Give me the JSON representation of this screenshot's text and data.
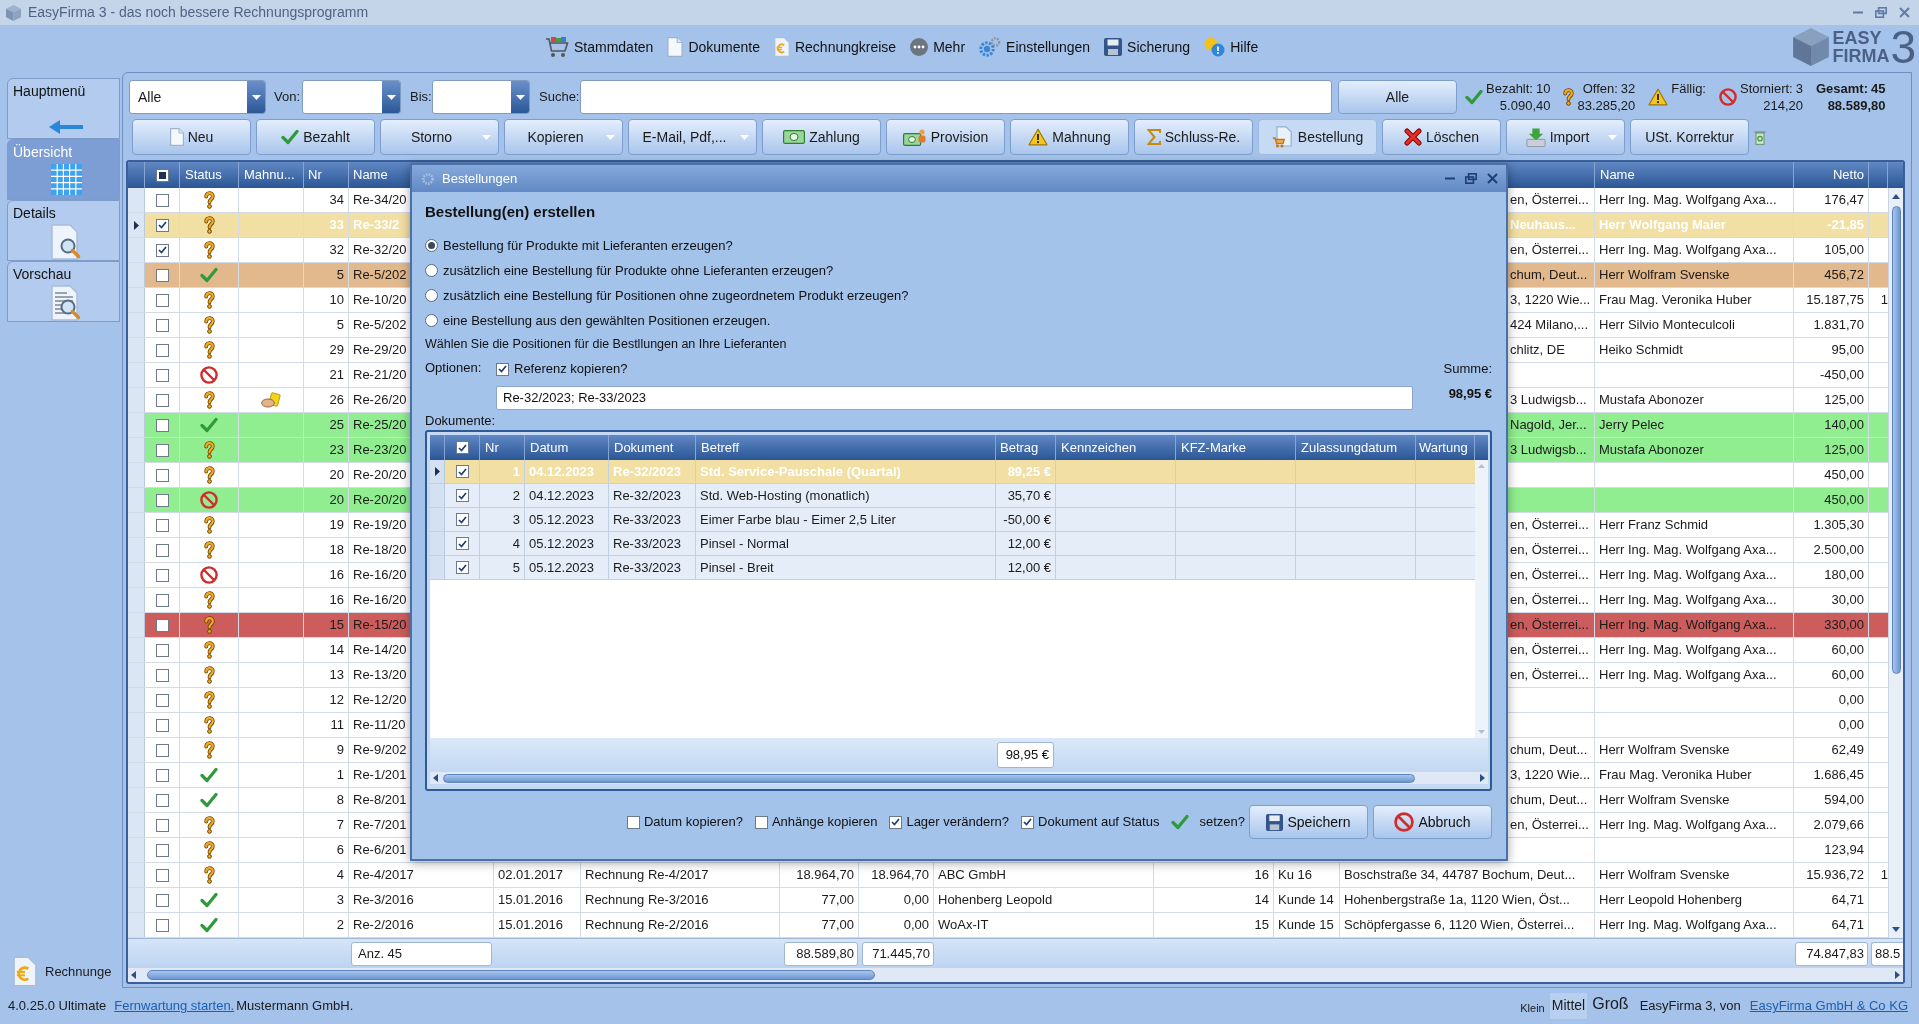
{
  "window": {
    "title": "EasyFirma 3 - das noch bessere Rechnungsprogramm"
  },
  "menu": [
    "Stammdaten",
    "Dokumente",
    "Rechnungkreise",
    "Mehr",
    "Einstellungen",
    "Sicherung",
    "Hilfe"
  ],
  "logo": {
    "line_1": "EASY",
    "line_2": "FIRMA",
    "version": "3"
  },
  "sidebar": {
    "tabs": [
      {
        "label": "Hauptmenü",
        "selected": false
      },
      {
        "label": "Übersicht",
        "selected": true
      },
      {
        "label": "Details",
        "selected": false
      },
      {
        "label": "Vorschau",
        "selected": false
      }
    ],
    "module": "Rechnunge"
  },
  "filter": {
    "type": "Alle",
    "from_label": "Von:",
    "to_label": "Bis:",
    "search_label": "Suche:",
    "reset_button": "Alle"
  },
  "stats": [
    {
      "label": "Bezahlt:",
      "count": "10",
      "amount": "5.090,40"
    },
    {
      "label": "Offen:",
      "count": "32",
      "amount": "83.285,20"
    },
    {
      "label": "Fällig:"
    },
    {
      "label": "Storniert:",
      "count": "3",
      "amount": "214,20"
    }
  ],
  "total": {
    "label": "Gesamt:",
    "count": "45",
    "amount": "88.589,80"
  },
  "toolbar": [
    {
      "label": "Neu",
      "dropdown": false,
      "pressed": false
    },
    {
      "label": "Bezahlt",
      "dropdown": false,
      "pressed": false
    },
    {
      "label": "Storno",
      "dropdown": true,
      "pressed": false
    },
    {
      "label": "Kopieren",
      "dropdown": true,
      "pressed": false
    },
    {
      "label": "E-Mail, Pdf,...",
      "dropdown": true,
      "pressed": false
    },
    {
      "label": "Zahlung",
      "dropdown": false,
      "pressed": false
    },
    {
      "label": "Provision",
      "dropdown": false,
      "pressed": false
    },
    {
      "label": "Mahnung",
      "dropdown": false,
      "pressed": false
    },
    {
      "label": "Schluss-Re.",
      "dropdown": false,
      "pressed": false
    },
    {
      "label": "Bestellung",
      "dropdown": false,
      "pressed": true
    },
    {
      "label": "Löschen",
      "dropdown": false,
      "pressed": false
    },
    {
      "label": "Import",
      "dropdown": true,
      "pressed": false
    },
    {
      "label": "USt. Korrektur",
      "dropdown": false,
      "pressed": false
    }
  ],
  "table": {
    "select_all": {
      "checked": false,
      "mixed": true
    },
    "header_left": [
      "Status",
      "Mahnu...",
      "Nr",
      "Name"
    ],
    "header_right": [
      "Name",
      "Netto"
    ],
    "rows": [
      {
        "checked": false,
        "selected": false,
        "paid": false,
        "cancelled": false,
        "reminder": false,
        "nr": "34",
        "name": "Re-34/20",
        "column_13": "en, Österrei...",
        "name_2": "Herr Ing. Mag. Wolfgang Axa...",
        "netto": "176,47"
      },
      {
        "checked": true,
        "selected": true,
        "paid": false,
        "cancelled": false,
        "reminder": false,
        "nr": "33",
        "name": "Re-33/2",
        "column_13": "Neuhaus...",
        "name_2": "Herr Wolfgang Maier",
        "netto": "-21,85"
      },
      {
        "checked": true,
        "selected": false,
        "paid": false,
        "cancelled": false,
        "reminder": false,
        "nr": "32",
        "name": "Re-32/20",
        "column_13": "en, Österrei...",
        "name_2": "Herr Ing. Mag. Wolfgang Axa...",
        "netto": "105,00"
      },
      {
        "checked": false,
        "selected": false,
        "paid": true,
        "cancelled": false,
        "reminder": false,
        "nr": "5",
        "name": "Re-5/202",
        "column_13": "chum, Deut...",
        "name_2": "Herr Wolfram Svenske",
        "netto": "456,72",
        "color": "#e2b98c"
      },
      {
        "checked": false,
        "selected": false,
        "paid": false,
        "cancelled": false,
        "reminder": false,
        "nr": "10",
        "name": "Re-10/20",
        "column_13": "3, 1220 Wie...",
        "name_2": "Frau Mag. Veronika Huber",
        "netto": "15.187,75",
        "column_16": "1"
      },
      {
        "checked": false,
        "selected": false,
        "paid": false,
        "cancelled": false,
        "reminder": false,
        "nr": "5",
        "name": "Re-5/202",
        "column_13": "424 Milano,...",
        "name_2": "Herr Silvio Monteculcoli",
        "netto": "1.831,70"
      },
      {
        "checked": false,
        "selected": false,
        "paid": false,
        "cancelled": false,
        "reminder": false,
        "nr": "29",
        "name": "Re-29/20",
        "column_13": "chlitz, DE",
        "name_2": "Heiko Schmidt",
        "netto": "95,00"
      },
      {
        "checked": false,
        "selected": false,
        "paid": false,
        "cancelled": true,
        "reminder": false,
        "nr": "21",
        "name": "Re-21/20",
        "netto": "-450,00"
      },
      {
        "checked": false,
        "selected": false,
        "paid": false,
        "cancelled": false,
        "reminder": true,
        "nr": "26",
        "name": "Re-26/20",
        "column_13": "3 Ludwigsb...",
        "name_2": "Mustafa Abonozer",
        "netto": "125,00"
      },
      {
        "checked": false,
        "selected": false,
        "paid": true,
        "cancelled": false,
        "reminder": false,
        "nr": "25",
        "name": "Re-25/20",
        "column_13": "Nagold, Jer...",
        "name_2": "Jerry Pelec",
        "netto": "140,00",
        "color": "#90ee90"
      },
      {
        "checked": false,
        "selected": false,
        "paid": false,
        "cancelled": false,
        "reminder": false,
        "nr": "23",
        "name": "Re-23/20",
        "column_13": "3 Ludwigsb...",
        "name_2": "Mustafa Abonozer",
        "netto": "125,00",
        "color": "#90ee90"
      },
      {
        "checked": false,
        "selected": false,
        "paid": false,
        "cancelled": false,
        "reminder": false,
        "nr": "20",
        "name": "Re-20/20",
        "netto": "450,00"
      },
      {
        "checked": false,
        "selected": false,
        "paid": false,
        "cancelled": true,
        "reminder": false,
        "nr": "20",
        "name": "Re-20/20",
        "netto": "450,00",
        "color": "#90ee90"
      },
      {
        "checked": false,
        "selected": false,
        "paid": false,
        "cancelled": false,
        "reminder": false,
        "nr": "19",
        "name": "Re-19/20",
        "column_13": "en, Österrei...",
        "name_2": "Herr Franz Schmid",
        "netto": "1.305,30"
      },
      {
        "checked": false,
        "selected": false,
        "paid": false,
        "cancelled": false,
        "reminder": false,
        "nr": "18",
        "name": "Re-18/20",
        "column_13": "en, Österrei...",
        "name_2": "Herr Ing. Mag. Wolfgang Axa...",
        "netto": "2.500,00"
      },
      {
        "checked": false,
        "selected": false,
        "paid": false,
        "cancelled": true,
        "reminder": false,
        "nr": "16",
        "name": "Re-16/20",
        "column_13": "en, Österrei...",
        "name_2": "Herr Ing. Mag. Wolfgang Axa...",
        "netto": "180,00"
      },
      {
        "checked": false,
        "selected": false,
        "paid": false,
        "cancelled": false,
        "reminder": false,
        "nr": "16",
        "name": "Re-16/20",
        "column_13": "en, Österrei...",
        "name_2": "Herr Ing. Mag. Wolfgang Axa...",
        "netto": "30,00"
      },
      {
        "checked": false,
        "selected": false,
        "paid": false,
        "cancelled": false,
        "reminder": false,
        "nr": "15",
        "name": "Re-15/20",
        "column_13": "en, Österrei...",
        "name_2": "Herr Ing. Mag. Wolfgang Axa...",
        "netto": "330,00",
        "color": "#cd5c5c"
      },
      {
        "checked": false,
        "selected": false,
        "paid": false,
        "cancelled": false,
        "reminder": false,
        "nr": "14",
        "name": "Re-14/20",
        "column_13": "en, Österrei...",
        "name_2": "Herr Ing. Mag. Wolfgang Axa...",
        "netto": "60,00"
      },
      {
        "checked": false,
        "selected": false,
        "paid": false,
        "cancelled": false,
        "reminder": false,
        "nr": "13",
        "name": "Re-13/20",
        "column_13": "en, Österrei...",
        "name_2": "Herr Ing. Mag. Wolfgang Axa...",
        "netto": "60,00"
      },
      {
        "checked": false,
        "selected": false,
        "paid": false,
        "cancelled": false,
        "reminder": false,
        "nr": "12",
        "name": "Re-12/20",
        "netto": "0,00"
      },
      {
        "checked": false,
        "selected": false,
        "paid": false,
        "cancelled": false,
        "reminder": false,
        "nr": "11",
        "name": "Re-11/20",
        "netto": "0,00"
      },
      {
        "checked": false,
        "selected": false,
        "paid": false,
        "cancelled": false,
        "reminder": false,
        "nr": "9",
        "name": "Re-9/202",
        "column_13": "chum, Deut...",
        "name_2": "Herr Wolfram Svenske",
        "netto": "62,49"
      },
      {
        "checked": false,
        "selected": false,
        "paid": true,
        "cancelled": false,
        "reminder": false,
        "nr": "1",
        "name": "Re-1/201",
        "column_13": "3, 1220 Wie...",
        "name_2": "Frau Mag. Veronika Huber",
        "netto": "1.686,45"
      },
      {
        "checked": false,
        "selected": false,
        "paid": true,
        "cancelled": false,
        "reminder": false,
        "nr": "8",
        "name": "Re-8/201",
        "column_13": "chum, Deut...",
        "name_2": "Herr Wolfram Svenske",
        "netto": "594,00"
      },
      {
        "checked": false,
        "selected": false,
        "paid": false,
        "cancelled": false,
        "reminder": false,
        "nr": "7",
        "name": "Re-7/201",
        "column_13": "en, Österrei...",
        "name_2": "Herr Ing. Mag. Wolfgang Axa...",
        "netto": "2.079,66"
      },
      {
        "checked": false,
        "selected": false,
        "paid": false,
        "cancelled": false,
        "reminder": false,
        "nr": "6",
        "name": "Re-6/201",
        "netto": "123,94"
      },
      {
        "checked": false,
        "selected": false,
        "paid": false,
        "cancelled": false,
        "reminder": false,
        "nr": "4",
        "name": "Re-4/2017",
        "column_6": "02.01.2017",
        "column_7": "Rechnung Re-4/2017",
        "column_8": "18.964,70",
        "column_9": "18.964,70",
        "column_10": "ABC GmbH",
        "column_11": "16",
        "column_12": "Ku 16",
        "column_13": "Boschstraße 34, 44787 Bochum, Deut...",
        "name_2": "Herr Wolfram Svenske",
        "netto": "15.936,72",
        "column_16": "1"
      },
      {
        "checked": false,
        "selected": false,
        "paid": true,
        "cancelled": false,
        "reminder": false,
        "nr": "3",
        "name": "Re-3/2016",
        "column_6": "15.01.2016",
        "column_7": "Rechnung Re-3/2016",
        "column_8": "77,00",
        "column_9": "0,00",
        "column_10": "Hohenberg Leopold",
        "column_11": "14",
        "column_12": "Kunde 14",
        "column_13": "Hohenbergstraße 1a, 1120 Wien, Öst...",
        "name_2": "Herr Leopold Hohenberg",
        "netto": "64,71"
      },
      {
        "checked": false,
        "selected": false,
        "paid": true,
        "cancelled": false,
        "reminder": false,
        "nr": "2",
        "name": "Re-2/2016",
        "column_6": "15.01.2016",
        "column_7": "Rechnung Re-2/2016",
        "column_8": "77,00",
        "column_9": "0,00",
        "column_10": "WoAx-IT",
        "column_11": "15",
        "column_12": "Kunde 15",
        "column_13": "Schöpfergasse 6, 1120 Wien, Österrei...",
        "name_2": "Herr Ing. Mag. Wolfgang Axa...",
        "netto": "64,71"
      }
    ],
    "footer": {
      "count": "Anz. 45",
      "column_8": "88.589,80",
      "column_9": "71.445,70",
      "netto": "74.847,83",
      "column_16": "88.5"
    }
  },
  "dialog": {
    "title": "Bestellungen",
    "heading": "Bestellung(en) erstellen",
    "modes": [
      {
        "label": "Bestellung für Produkte mit Lieferanten erzeugen?",
        "selected": true
      },
      {
        "label": "zusätzlich eine Bestellung für Produkte ohne Lieferanten erzeugen?",
        "selected": false
      },
      {
        "label": "zusätzlich eine Bestellung für Positionen ohne zugeordnetem Produkt erzeugen?",
        "selected": false
      },
      {
        "label": "eine Bestellung aus den gewählten Positionen erzeugen.",
        "selected": false
      }
    ],
    "hint": "Wählen Sie die Positionen für die Bestllungen an Ihre Lieferanten",
    "options_label": "Optionen:",
    "copy_reference": {
      "label": "Referenz kopieren?",
      "checked": true
    },
    "reference": "Re-32/2023; Re-33/2023",
    "sum_label": "Summe:",
    "sum": "98,95 €",
    "documents_label": "Dokumente:",
    "grid": {
      "select_all": true,
      "columns": [
        "Nr",
        "Datum",
        "Dokument",
        "Betreff",
        "Betrag",
        "Kennzeichen",
        "KFZ-Marke",
        "Zulassungdatum",
        "Wartung"
      ],
      "rows": [
        {
          "checked": true,
          "selected": true,
          "nr": "1",
          "datum": "04.12.2023",
          "dokument": "Re-32/2023",
          "betreff": "Std. Service-Pauschale (Quartal)",
          "betrag": "89,25 €"
        },
        {
          "checked": true,
          "selected": false,
          "nr": "2",
          "datum": "04.12.2023",
          "dokument": "Re-32/2023",
          "betreff": "Std. Web-Hosting (monatlich)",
          "betrag": "35,70 €"
        },
        {
          "checked": true,
          "selected": false,
          "nr": "3",
          "datum": "05.12.2023",
          "dokument": "Re-33/2023",
          "betreff": "Eimer Farbe blau - Eimer 2,5 Liter",
          "betrag": "-50,00 €"
        },
        {
          "checked": true,
          "selected": false,
          "nr": "4",
          "datum": "05.12.2023",
          "dokument": "Re-33/2023",
          "betreff": "Pinsel - Normal",
          "betrag": "12,00 €"
        },
        {
          "checked": true,
          "selected": false,
          "nr": "5",
          "datum": "05.12.2023",
          "dokument": "Re-33/2023",
          "betreff": "Pinsel - Breit",
          "betrag": "12,00 €"
        }
      ],
      "total": "98,95 €"
    },
    "flags": [
      {
        "label": "Datum kopieren?",
        "checked": false
      },
      {
        "label": "Anhänge kopieren",
        "checked": false
      },
      {
        "label": "Lager verändern?",
        "checked": true
      },
      {
        "label": "Dokument auf Status",
        "checked": true,
        "suffix": "setzen?"
      }
    ],
    "buttons": [
      "Speichern",
      "Abbruch"
    ]
  },
  "status_bar": {
    "version": "4.0.25.0 Ultimate",
    "remote_link": "Fernwartung starten.",
    "company": "Mustermann GmbH.",
    "sizes": [
      {
        "label": "Klein",
        "selected": false
      },
      {
        "label": "Mittel",
        "selected": true
      },
      {
        "label": "Groß",
        "selected": false
      }
    ],
    "credit": "EasyFirma 3, von",
    "vendor_link": "EasyFirma GmbH & Co KG"
  }
}
